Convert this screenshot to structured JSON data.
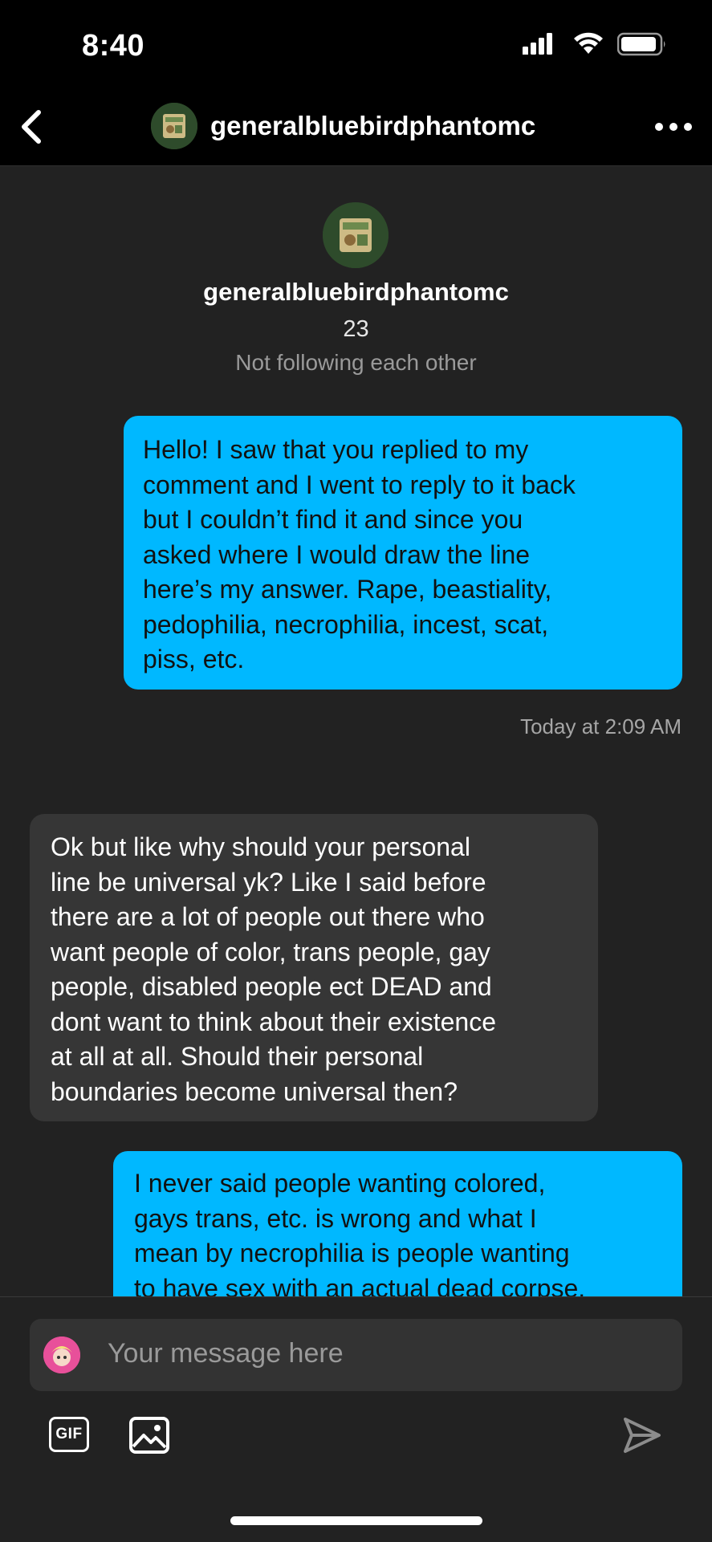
{
  "status_bar": {
    "time": "8:40"
  },
  "header": {
    "username": "generalbluebirdphantomc"
  },
  "profile": {
    "username": "generalbluebirdphantomc",
    "count": "23",
    "relationship": "Not following each other"
  },
  "messages": [
    {
      "direction": "outgoing",
      "text": "Hello! I saw that you replied to my\ncomment and I went to reply to it back\nbut I couldn’t find it and since you\nasked where I would draw the line\nhere’s my answer.  Rape, beastiality,\npedophilia, necrophilia, incest, scat,\npiss, etc."
    },
    {
      "direction": "incoming",
      "text": "Ok but like why should your personal\nline be universal yk? Like I said before\nthere are a lot of people out there who\nwant people of color, trans people, gay\npeople, disabled people ect DEAD and\ndont want to think about their existence\nat all at all. Should their personal\nboundaries become universal then?"
    },
    {
      "direction": "outgoing",
      "text": "I never said people wanting colored,\ngays trans, etc. is wrong and what I\nmean by necrophilia is people wanting\nto have sex with an actual dead corpse."
    }
  ],
  "timestamp": "Today at 2:09 AM",
  "composer": {
    "placeholder": "Your message here",
    "gif_label": "GIF"
  },
  "colors": {
    "outgoing_bubble": "#00b8ff",
    "incoming_bubble": "#363636",
    "background": "#222222"
  }
}
